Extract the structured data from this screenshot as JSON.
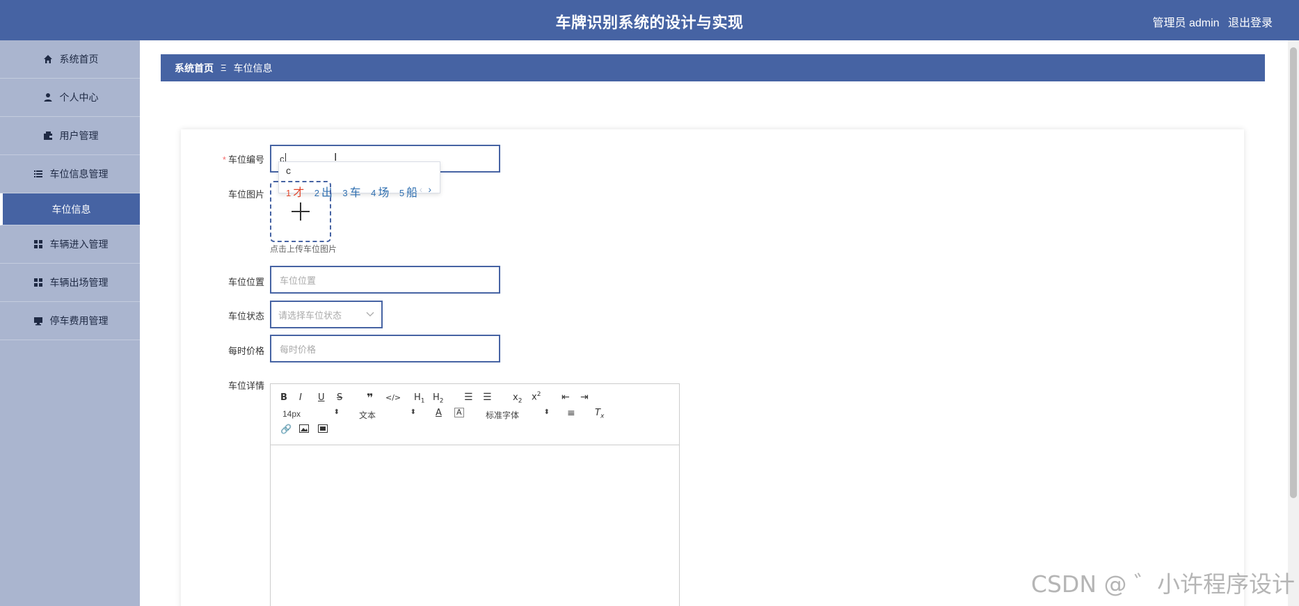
{
  "header": {
    "title": "车牌识别系统的设计与实现",
    "user_label": "管理员 admin",
    "logout_label": "退出登录"
  },
  "sidebar": {
    "items": [
      {
        "label": "系统首页",
        "icon": "home-icon"
      },
      {
        "label": "个人中心",
        "icon": "person-icon"
      },
      {
        "label": "用户管理",
        "icon": "wallet-icon"
      },
      {
        "label": "车位信息管理",
        "icon": "list-icon"
      },
      {
        "label": "车辆进入管理",
        "icon": "grid-icon"
      },
      {
        "label": "车辆出场管理",
        "icon": "grid-icon"
      },
      {
        "label": "停车费用管理",
        "icon": "monitor-icon"
      }
    ],
    "subitem": {
      "label": "车位信息"
    }
  },
  "breadcrumb": {
    "home": "系统首页",
    "separator": "Ξ",
    "current": "车位信息"
  },
  "form": {
    "space_no": {
      "label": "车位编号",
      "value": "c"
    },
    "ime": {
      "typed": "c",
      "candidates": [
        "才",
        "出",
        "车",
        "场",
        "船"
      ],
      "numbers": [
        "1",
        "2",
        "3",
        "4",
        "5"
      ]
    },
    "image": {
      "label": "车位图片",
      "tip": "点击上传车位图片"
    },
    "location": {
      "label": "车位位置",
      "placeholder": "车位位置"
    },
    "status": {
      "label": "车位状态",
      "placeholder": "请选择车位状态"
    },
    "price": {
      "label": "每时价格",
      "placeholder": "每时价格"
    },
    "detail": {
      "label": "车位详情",
      "font_size": "14px",
      "text_type": "文本",
      "font_family": "标准字体"
    }
  },
  "watermark": "CSDN @ ゛小许程序设计",
  "colors": {
    "primary": "#4663a3",
    "sidebar_bg": "#aab5cf",
    "required": "#f56c6c"
  }
}
